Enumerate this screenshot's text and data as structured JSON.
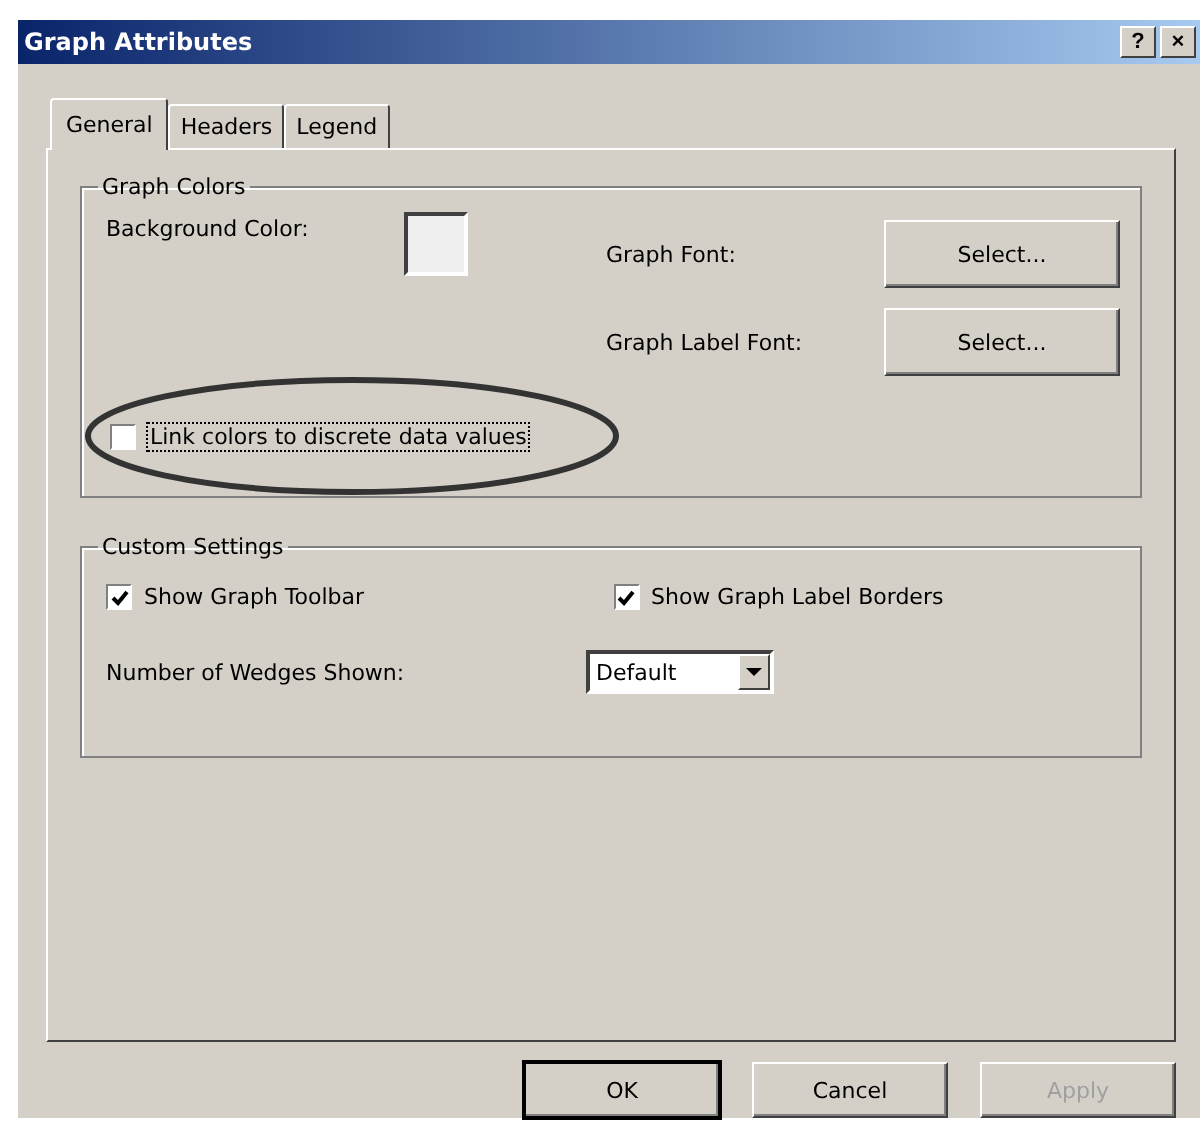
{
  "window": {
    "title": "Graph Attributes",
    "help": "?",
    "close": "×"
  },
  "tabs": [
    {
      "label": "General",
      "selected": true
    },
    {
      "label": "Headers",
      "selected": false
    },
    {
      "label": "Legend",
      "selected": false
    }
  ],
  "graph_colors": {
    "title": "Graph Colors",
    "background_label": "Background Color:",
    "fonts": [
      {
        "label": "Graph Font:",
        "button": "Select..."
      },
      {
        "label": "Graph Label Font:",
        "button": "Select..."
      }
    ],
    "link_colors": {
      "label": "Link colors to discrete data values",
      "checked": false,
      "circled": true
    }
  },
  "custom_settings": {
    "title": "Custom Settings",
    "checkboxes": [
      {
        "label": "Show Graph Toolbar",
        "checked": true
      },
      {
        "label": "Show Graph Label Borders",
        "checked": true
      }
    ],
    "wedges": {
      "label": "Number of Wedges Shown:",
      "value": "Default"
    }
  },
  "buttons": [
    {
      "label": "OK",
      "default": true,
      "disabled": false
    },
    {
      "label": "Cancel",
      "default": false,
      "disabled": false
    },
    {
      "label": "Apply",
      "default": false,
      "disabled": true
    }
  ]
}
